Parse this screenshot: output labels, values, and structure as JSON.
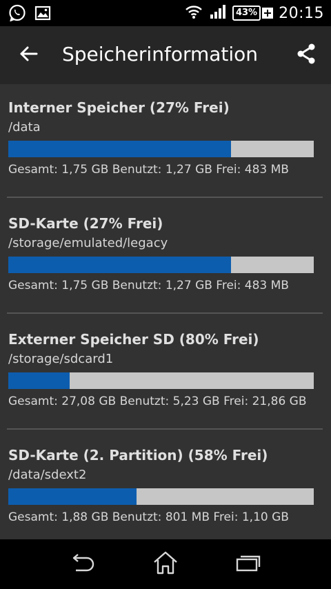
{
  "status_bar": {
    "clock": "20:15",
    "battery_percent": "43%",
    "left_icons": [
      "whatsapp-icon",
      "image-icon"
    ],
    "right_icons": [
      "wifi-icon",
      "signal-icon",
      "battery-icon"
    ]
  },
  "action_bar": {
    "title": "Speicherinformation",
    "back_icon": "arrow-back-icon",
    "share_icon": "share-icon"
  },
  "colors": {
    "used": "#0d5dae",
    "free": "#c6c6c6",
    "background": "#323232",
    "action_bar": "#262626"
  },
  "storage": [
    {
      "title": "Interner Speicher (27% Frei)",
      "path": "/data",
      "used_fraction": 0.73,
      "stats": "Gesamt: 1,75 GB Benutzt: 1,27 GB Frei: 483 MB"
    },
    {
      "title": "SD-Karte (27% Frei)",
      "path": "/storage/emulated/legacy",
      "used_fraction": 0.73,
      "stats": "Gesamt: 1,75 GB Benutzt: 1,27 GB Frei: 483 MB"
    },
    {
      "title": "Externer Speicher SD (80% Frei)",
      "path": "/storage/sdcard1",
      "used_fraction": 0.2,
      "stats": "Gesamt: 27,08 GB Benutzt: 5,23 GB Frei: 21,86 GB"
    },
    {
      "title": "SD-Karte (2. Partition) (58% Frei)",
      "path": "/data/sdext2",
      "used_fraction": 0.42,
      "stats": "Gesamt: 1,88 GB Benutzt: 801 MB Frei: 1,10 GB"
    }
  ],
  "nav_bar": {
    "buttons": [
      "back-nav-icon",
      "home-nav-icon",
      "recents-nav-icon"
    ]
  }
}
